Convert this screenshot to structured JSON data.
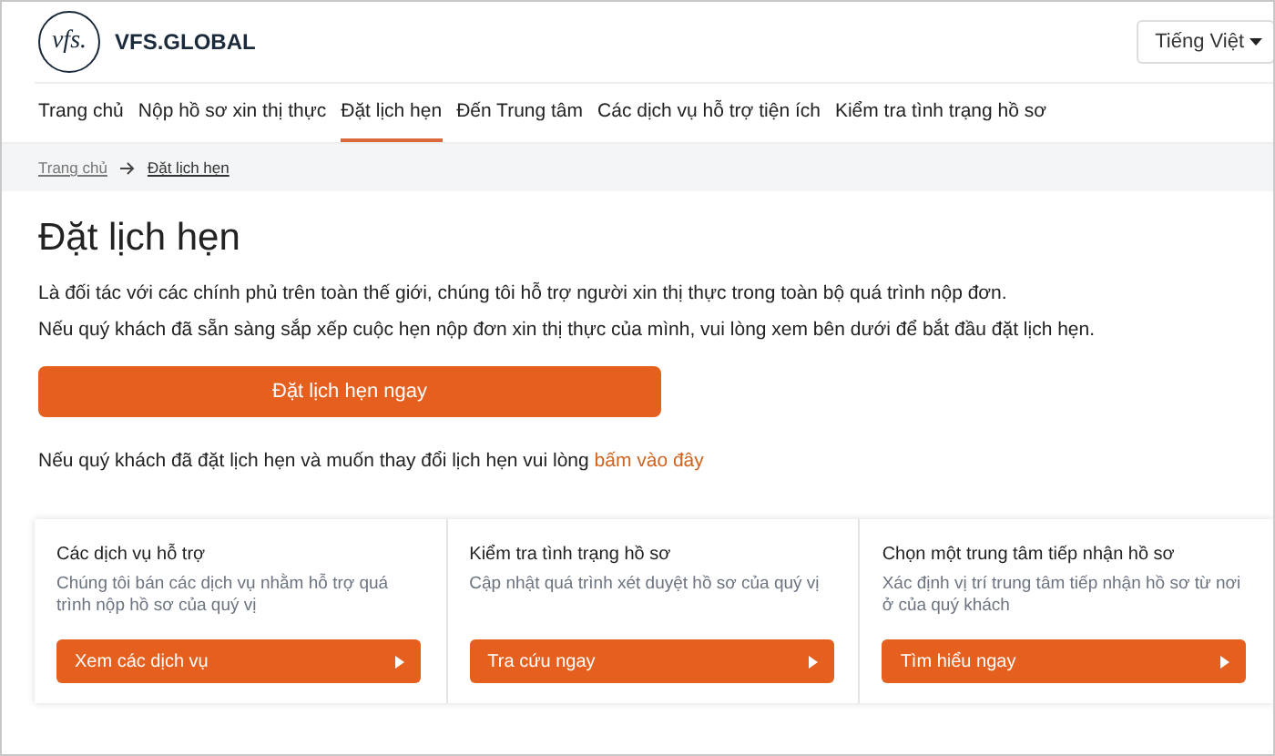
{
  "header": {
    "logo_mark": "vfs.",
    "brand": "VFS.GLOBAL",
    "language": "Tiếng Việt"
  },
  "nav": [
    {
      "label": "Trang chủ",
      "selected": false
    },
    {
      "label": "Nộp hồ sơ xin thị thực",
      "selected": false
    },
    {
      "label": "Đặt lịch hẹn",
      "selected": true
    },
    {
      "label": "Đến Trung tâm",
      "selected": false
    },
    {
      "label": "Các dịch vụ hỗ trợ tiện ích",
      "selected": false
    },
    {
      "label": "Kiểm tra tình trạng hồ sơ",
      "selected": false
    }
  ],
  "breadcrumb": [
    "Trang chủ",
    "Đặt lịch hẹn"
  ],
  "title": "Đặt lịch hẹn",
  "paragraphs": [
    "Là đối tác với các chính phủ trên toàn thế giới, chúng tôi hỗ trợ người xin thị thực trong toàn bộ quá trình nộp đơn.",
    "Nếu quý khách đã sẵn sàng sắp xếp cuộc hẹn nộp đơn xin thị thực của mình, vui lòng xem bên dưới để bắt đầu đặt lịch hẹn."
  ],
  "book_button": "Đặt lịch hẹn ngay",
  "change_note": {
    "text": "Nếu quý khách đã đặt lịch hẹn và muốn thay đổi lịch hẹn vui lòng",
    "link": "bấm vào đây"
  },
  "cards": [
    {
      "title": "Các dịch vụ hỗ trợ",
      "description": "Chúng tôi bán các dịch vụ nhằm hỗ trợ quá trình nộp hồ sơ của quý vị",
      "button": "Xem các dịch vụ"
    },
    {
      "title": "Kiểm tra tình trạng hồ sơ",
      "description": "Cập nhật quá trình xét duyệt hồ sơ của quý vị",
      "button": "Tra cứu ngay"
    },
    {
      "title": "Chọn một trung tâm tiếp nhận hồ sơ",
      "description": "Xác định vị trí trung tâm tiếp nhận hồ sơ từ nơi ở của quý khách",
      "button": "Tìm hiểu ngay"
    }
  ]
}
